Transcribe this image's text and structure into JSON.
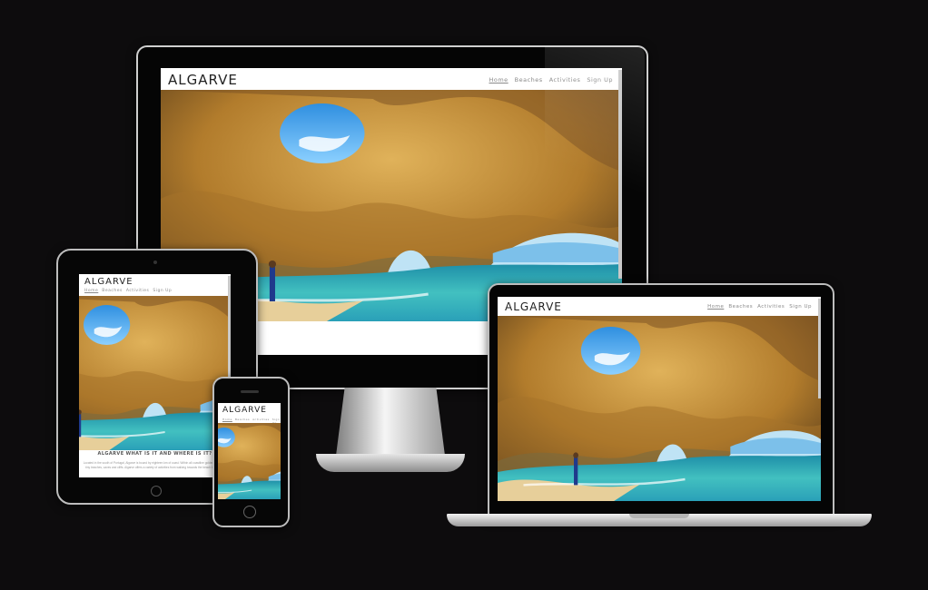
{
  "site": {
    "brand": "ALGARVE",
    "nav": [
      "Home",
      "Beaches",
      "Activities",
      "Sign Up"
    ],
    "section_heading": "ALGARVE WHAT IS IT AND WHERE IS IT?",
    "paragraph": "Located in the south of Portugal, Algarve is bound by eighteen km of coast. Within all coastline golden sand and tiny beaches, caves and cliffs. Algarve offers a variety of activities from walking towards the beach to surfing."
  },
  "devices": [
    "desktop-monitor",
    "tablet",
    "laptop",
    "smartphone"
  ],
  "colors": {
    "background": "#0d0c0d",
    "sky": "#3f9fe5",
    "rock": "#c48a2a",
    "sea": "#37b3b0"
  }
}
